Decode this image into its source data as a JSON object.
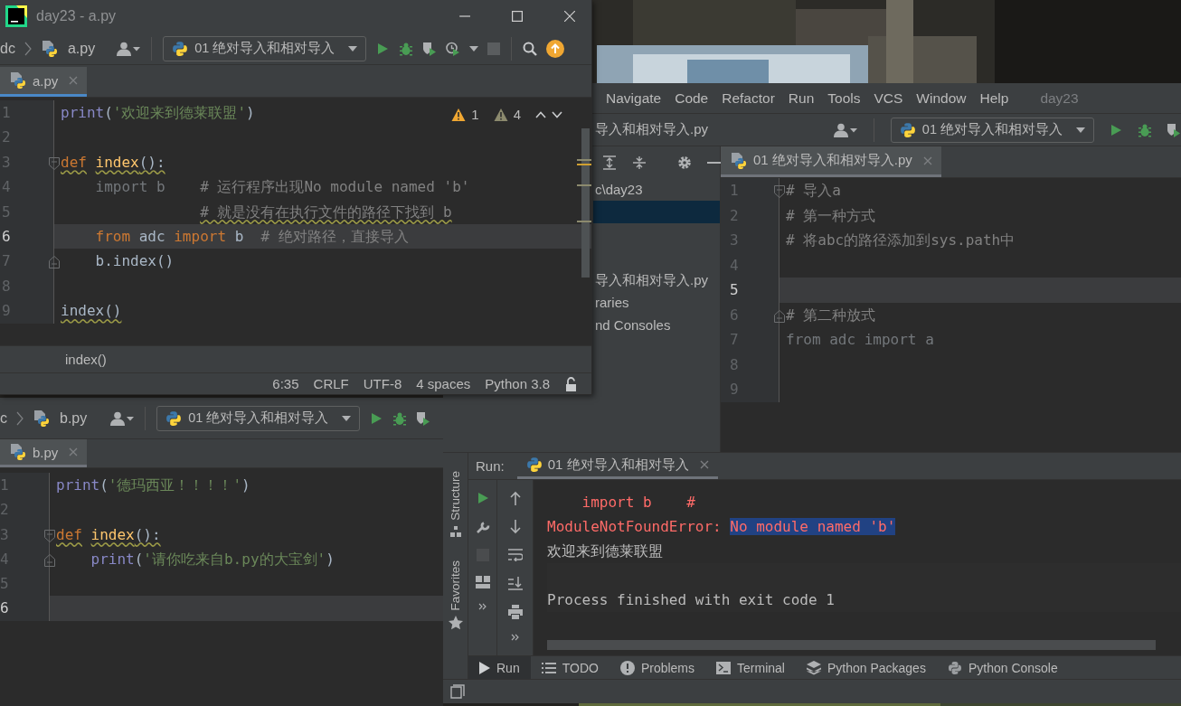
{
  "main_window": {
    "menu": [
      "Navigate",
      "Code",
      "Refactor",
      "Run",
      "Tools",
      "VCS",
      "Window",
      "Help"
    ],
    "project_name": "day23",
    "breadcrumb": "导入和相对导入.py",
    "run_config": "01 绝对导入和相对导入",
    "project_tree": [
      {
        "label": "c\\day23",
        "selected": false
      },
      {
        "selected": true
      },
      {
        "selected": false
      },
      {
        "selected": false
      },
      {
        "label": "导入和相对导入.py",
        "selected": false
      },
      {
        "label": "raries",
        "selected": false
      },
      {
        "label": "nd Consoles",
        "selected": false
      }
    ],
    "editor_tab": {
      "label": "01 绝对导入和相对导入.py",
      "selected": true
    },
    "lines": [
      {
        "n": "1",
        "current": false,
        "fold_start": true,
        "code": [
          {
            "kind": "comment",
            "text": "# 导入a"
          }
        ]
      },
      {
        "n": "2",
        "current": false,
        "code": [
          {
            "kind": "comment",
            "text": "# 第一种方式"
          }
        ]
      },
      {
        "n": "3",
        "current": false,
        "code": [
          {
            "kind": "comment",
            "text": "# 将abc的路径添加到sys.path中"
          }
        ]
      },
      {
        "n": "4",
        "current": false
      },
      {
        "n": "5",
        "current": true
      },
      {
        "n": "6",
        "current": false,
        "fold_end": true,
        "code": [
          {
            "kind": "comment",
            "text": "# 第二种放式"
          }
        ]
      },
      {
        "n": "7",
        "current": false,
        "code": [
          {
            "kind": "dim",
            "text": "from adc import a"
          }
        ]
      },
      {
        "n": "8",
        "current": false
      },
      {
        "n": "9",
        "current": false
      }
    ],
    "run_panel": {
      "title": "Run:",
      "tab": "01 绝对导入和相对导入",
      "output": [
        {
          "segments": [
            {
              "kind": "error",
              "text": "    import b    #"
            }
          ]
        },
        {
          "segments": [
            {
              "kind": "error",
              "text": "ModuleNotFoundError: ",
              "selected": false
            },
            {
              "kind": "error",
              "text": "No module named 'b'",
              "selected": true
            }
          ]
        },
        {
          "segments": [
            {
              "kind": "plain",
              "text": "欢迎来到德莱联盟"
            }
          ]
        },
        {
          "gap_before": true,
          "segments": [
            {
              "kind": "plain",
              "text": "Process finished with exit code 1"
            }
          ]
        }
      ]
    },
    "side_labels": [
      "Structure",
      "Favorites"
    ],
    "tool_tabs": [
      {
        "label": "Run",
        "selected": true
      },
      {
        "label": "TODO",
        "selected": false
      },
      {
        "label": "Problems",
        "selected": false
      },
      {
        "label": "Terminal",
        "selected": false
      },
      {
        "label": "Python Packages",
        "selected": false
      },
      {
        "label": "Python Console",
        "selected": false
      }
    ]
  },
  "editor_a": {
    "title": "day23 - a.py",
    "breadcrumb_root": "dc",
    "breadcrumb_file": "a.py",
    "run_config": "01 绝对导入和相对导入",
    "tab": {
      "label": "a.py",
      "selected": true
    },
    "inspections": {
      "warnings": "1",
      "weak_warnings": "4"
    },
    "lines": [
      {
        "n": "1",
        "current": false,
        "code": [
          {
            "kind": "builtin",
            "text": "print"
          },
          {
            "kind": "plain",
            "text": "("
          },
          {
            "kind": "string",
            "text": "'欢迎来到德莱联盟'"
          },
          {
            "kind": "plain",
            "text": ")"
          }
        ]
      },
      {
        "n": "2",
        "current": false
      },
      {
        "n": "3",
        "current": false,
        "fold_start": true,
        "code": [
          {
            "kind": "keyword",
            "text": "def",
            "warn": true
          },
          {
            "kind": "name",
            "text": " index",
            "warn": true
          },
          {
            "kind": "plain",
            "text": "():",
            "warn": true
          }
        ]
      },
      {
        "n": "4",
        "current": false,
        "code": [
          {
            "kind": "dim",
            "text": "    import b"
          },
          {
            "kind": "comment",
            "text": "    # 运行程序出现No module named 'b'"
          }
        ]
      },
      {
        "n": "5",
        "current": false,
        "code": [
          {
            "kind": "comment",
            "text": "                # 就是没有在执行文件的路径下找到 b",
            "warn": true
          }
        ]
      },
      {
        "n": "6",
        "current": true,
        "code": [
          {
            "kind": "keyword",
            "text": "    from"
          },
          {
            "kind": "plain",
            "text": " adc "
          },
          {
            "kind": "keyword",
            "text": "import"
          },
          {
            "kind": "plain",
            "text": " b  "
          },
          {
            "kind": "comment",
            "text": "# 绝对路径，直接导入"
          }
        ]
      },
      {
        "n": "7",
        "current": false,
        "fold_end": true,
        "code": [
          {
            "kind": "plain",
            "text": "    b.index()"
          }
        ]
      },
      {
        "n": "8",
        "current": false
      },
      {
        "n": "9",
        "current": false,
        "code": [
          {
            "kind": "plain",
            "text": "index()",
            "warn": true
          }
        ]
      }
    ],
    "code_breadcrumb": "index()",
    "status": [
      "6:35",
      "CRLF",
      "UTF-8",
      "4 spaces",
      "Python 3.8"
    ]
  },
  "editor_b": {
    "breadcrumb_root": "c",
    "breadcrumb_file": "b.py",
    "run_config": "01 绝对导入和相对导入",
    "tab": {
      "label": "b.py",
      "selected": true
    },
    "lines": [
      {
        "n": "1",
        "current": false,
        "code": [
          {
            "kind": "builtin",
            "text": "print"
          },
          {
            "kind": "plain",
            "text": "("
          },
          {
            "kind": "string",
            "text": "'德玛西亚！！！！'"
          },
          {
            "kind": "plain",
            "text": ")"
          }
        ]
      },
      {
        "n": "2",
        "current": false
      },
      {
        "n": "3",
        "current": false,
        "fold_start": true,
        "code": [
          {
            "kind": "keyword",
            "text": "def",
            "warn": true
          },
          {
            "kind": "name",
            "text": " index",
            "warn": true
          },
          {
            "kind": "plain",
            "text": "():",
            "warn": true
          }
        ]
      },
      {
        "n": "4",
        "current": false,
        "fold_end": true,
        "code": [
          {
            "kind": "builtin",
            "text": "    print"
          },
          {
            "kind": "plain",
            "text": "("
          },
          {
            "kind": "string",
            "text": "'请你吃来自b.py的大宝剑'"
          },
          {
            "kind": "plain",
            "text": ")"
          }
        ]
      },
      {
        "n": "5",
        "current": false
      },
      {
        "n": "6",
        "current": true
      }
    ]
  }
}
